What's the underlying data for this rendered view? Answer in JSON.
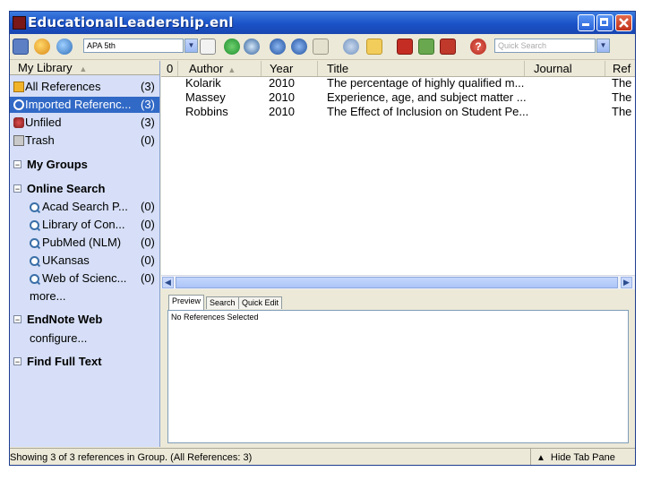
{
  "window": {
    "title": "EducationalLeadership.enl"
  },
  "toolbar": {
    "style_value": "APA 5th",
    "quick_search_placeholder": "Quick Search",
    "icons": [
      "library-icon",
      "globe-icon",
      "earth-icon",
      "edit-style-icon",
      "new-reference-icon",
      "online-search-icon",
      "import-icon",
      "export-icon",
      "find-text-icon",
      "open-link-icon",
      "open-folder-icon",
      "insert-citation-icon",
      "format-bibliography-icon",
      "return-to-word-icon",
      "help-icon"
    ]
  },
  "sidebar": {
    "header": "My Library",
    "items": [
      {
        "label": "All References",
        "count": "(3)"
      },
      {
        "label": "Imported Referenc...",
        "count": "(3)"
      },
      {
        "label": "Unfiled",
        "count": "(3)"
      },
      {
        "label": "Trash",
        "count": "(0)"
      }
    ],
    "groups": {
      "my_groups": "My Groups",
      "online_search": "Online Search",
      "endnote_web": "EndNote Web",
      "find_full_text": "Find Full Text"
    },
    "online": [
      {
        "label": "Acad Search P...",
        "count": "(0)"
      },
      {
        "label": "Library of Con...",
        "count": "(0)"
      },
      {
        "label": "PubMed (NLM)",
        "count": "(0)"
      },
      {
        "label": "UKansas",
        "count": "(0)"
      },
      {
        "label": "Web of Scienc...",
        "count": "(0)"
      }
    ],
    "more": "more...",
    "configure": "configure..."
  },
  "references": {
    "columns": {
      "attach": "0",
      "author": "Author",
      "year": "Year",
      "title": "Title",
      "journal": "Journal",
      "ref": "Ref"
    },
    "rows": [
      {
        "author": "Kolarik",
        "year": "2010",
        "title": "The percentage of highly qualified m...",
        "journal": "",
        "ref": "The"
      },
      {
        "author": "Massey",
        "year": "2010",
        "title": "Experience, age, and subject matter ...",
        "journal": "",
        "ref": "The"
      },
      {
        "author": "Robbins",
        "year": "2010",
        "title": "The Effect of Inclusion on Student Pe...",
        "journal": "",
        "ref": "The"
      }
    ]
  },
  "tabs": {
    "preview": "Preview",
    "search": "Search",
    "quick_edit": "Quick Edit"
  },
  "preview": {
    "text": "No References Selected"
  },
  "status": {
    "message": "Showing 3 of 3 references in Group. (All References: 3)",
    "hide_tab_pane": "Hide Tab Pane"
  },
  "colors": {
    "selection": "#3169c6",
    "sidebar": "#d6dff7",
    "titlebar": "#1a52c8"
  }
}
